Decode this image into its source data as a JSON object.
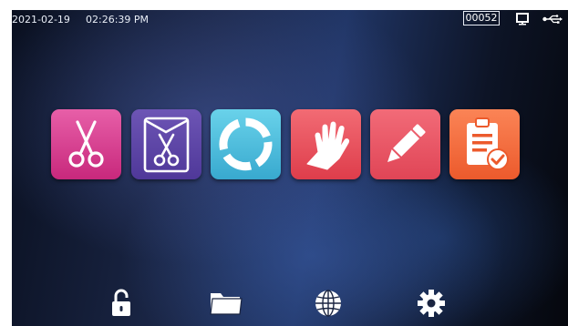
{
  "status_bar": {
    "date": "2021-02-19",
    "time": "02:26:39 PM",
    "counter": "00052",
    "monitor_icon": "monitor-icon",
    "usb_icon": "usb-icon"
  },
  "tiles": [
    {
      "icon": "scissors-icon",
      "color": "#d63b8e"
    },
    {
      "icon": "sealed-scissors-pouch-icon",
      "color": "#5c44a6"
    },
    {
      "icon": "cycle-ring-icon",
      "color": "#4bbcdc"
    },
    {
      "icon": "glove-icon",
      "color": "#e8525e"
    },
    {
      "icon": "pencil-icon",
      "color": "#ea5868"
    },
    {
      "icon": "clipboard-check-icon",
      "color": "#f46c3f"
    }
  ],
  "bottom_bar": [
    {
      "icon": "unlock-icon"
    },
    {
      "icon": "folder-icon"
    },
    {
      "icon": "globe-icon"
    },
    {
      "icon": "settings-gear-icon"
    }
  ]
}
